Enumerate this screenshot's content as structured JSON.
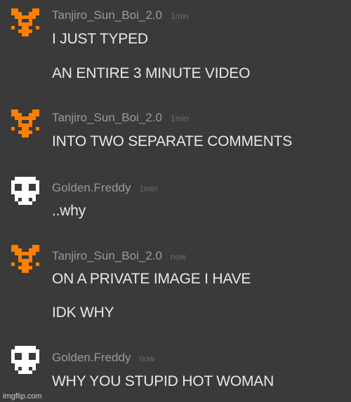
{
  "colors": {
    "background": "#3a3a3a",
    "fox_orange": "#ff7f00",
    "skull_white": "#ffffff",
    "username": "#9a9a9a",
    "text": "#e8e8e8"
  },
  "comments": [
    {
      "avatar": "fox-icon",
      "user": "Tanjiro_Sun_Boi_2.0",
      "time": "1min",
      "lines": [
        "I JUST TYPED",
        "AN ENTIRE 3 MINUTE VIDEO"
      ]
    },
    {
      "avatar": "fox-icon",
      "user": "Tanjiro_Sun_Boi_2.0",
      "time": "1min",
      "lines": [
        "INTO TWO SEPARATE COMMENTS"
      ]
    },
    {
      "avatar": "skull-icon",
      "user": "Golden.Freddy",
      "time": "1min",
      "lines": [
        "..why"
      ]
    },
    {
      "avatar": "fox-icon",
      "user": "Tanjiro_Sun_Boi_2.0",
      "time": "now",
      "lines": [
        "ON A PRIVATE IMAGE I HAVE",
        "IDK WHY"
      ]
    },
    {
      "avatar": "skull-icon",
      "user": "Golden.Freddy",
      "time": "now",
      "lines": [
        "WHY YOU STUPID HOT WOMAN"
      ]
    }
  ],
  "watermark": "imgflip.com"
}
